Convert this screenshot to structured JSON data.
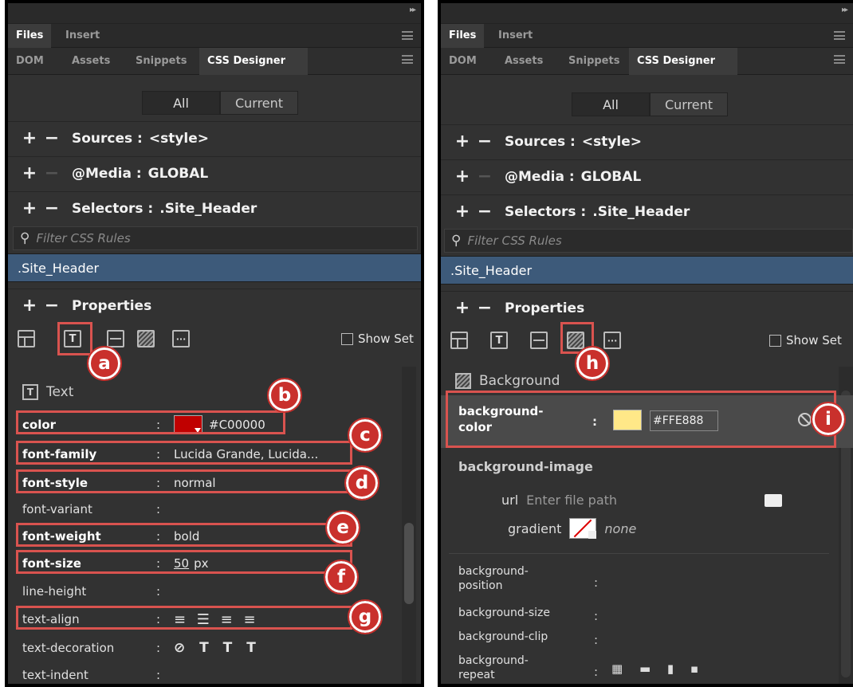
{
  "panel_tabs": {
    "files": "Files",
    "insert": "Insert"
  },
  "sub_tabs": {
    "dom": "DOM",
    "assets": "Assets",
    "snippets": "Snippets",
    "css_designer": "CSS Designer"
  },
  "mode": {
    "all": "All",
    "current": "Current"
  },
  "sources": {
    "label": "Sources :",
    "value": "<style>"
  },
  "media": {
    "label": "@Media :",
    "value": "GLOBAL"
  },
  "selectors": {
    "label": "Selectors :",
    "value": ".Site_Header"
  },
  "filter": {
    "placeholder": "Filter CSS Rules"
  },
  "selected_rule": ".Site_Header",
  "properties": {
    "label": "Properties",
    "show_set": "Show Set"
  },
  "callouts": {
    "a": "a",
    "b": "b",
    "c": "c",
    "d": "d",
    "e": "e",
    "f": "f",
    "g": "g",
    "h": "h",
    "i": "i"
  },
  "text_group": {
    "title": "Text",
    "color": {
      "name": "color",
      "value": "#C00000",
      "swatch": "#C00000"
    },
    "font_family": {
      "name": "font-family",
      "value": "Lucida Grande, Lucida..."
    },
    "font_style": {
      "name": "font-style",
      "value": "normal"
    },
    "font_variant": {
      "name": "font-variant"
    },
    "font_weight": {
      "name": "font-weight",
      "value": "bold"
    },
    "font_size": {
      "name": "font-size",
      "value": "50",
      "unit": "px"
    },
    "line_height": {
      "name": "line-height"
    },
    "text_align": {
      "name": "text-align",
      "icons": "≡ ☰ ≡ ≡"
    },
    "text_decoration": {
      "name": "text-decoration",
      "icons": "⊘ T T T"
    },
    "text_indent": {
      "name": "text-indent"
    }
  },
  "background_group": {
    "title": "Background",
    "bg_color": {
      "name_line1": "background-",
      "name_line2": "color",
      "value": "#FFE888",
      "swatch": "#FFE888"
    },
    "bg_image": {
      "name": "background-image",
      "url_label": "url",
      "url_placeholder": "Enter file path",
      "gradient_label": "gradient",
      "gradient_value": "none"
    },
    "bg_position": {
      "line1": "background-",
      "line2": "position"
    },
    "bg_size": {
      "name": "background-size"
    },
    "bg_clip": {
      "name": "background-clip"
    },
    "bg_repeat": {
      "line1": "background-",
      "line2": "repeat",
      "icons": "▦ ▬ ▮ ▪"
    }
  },
  "colon": ":"
}
